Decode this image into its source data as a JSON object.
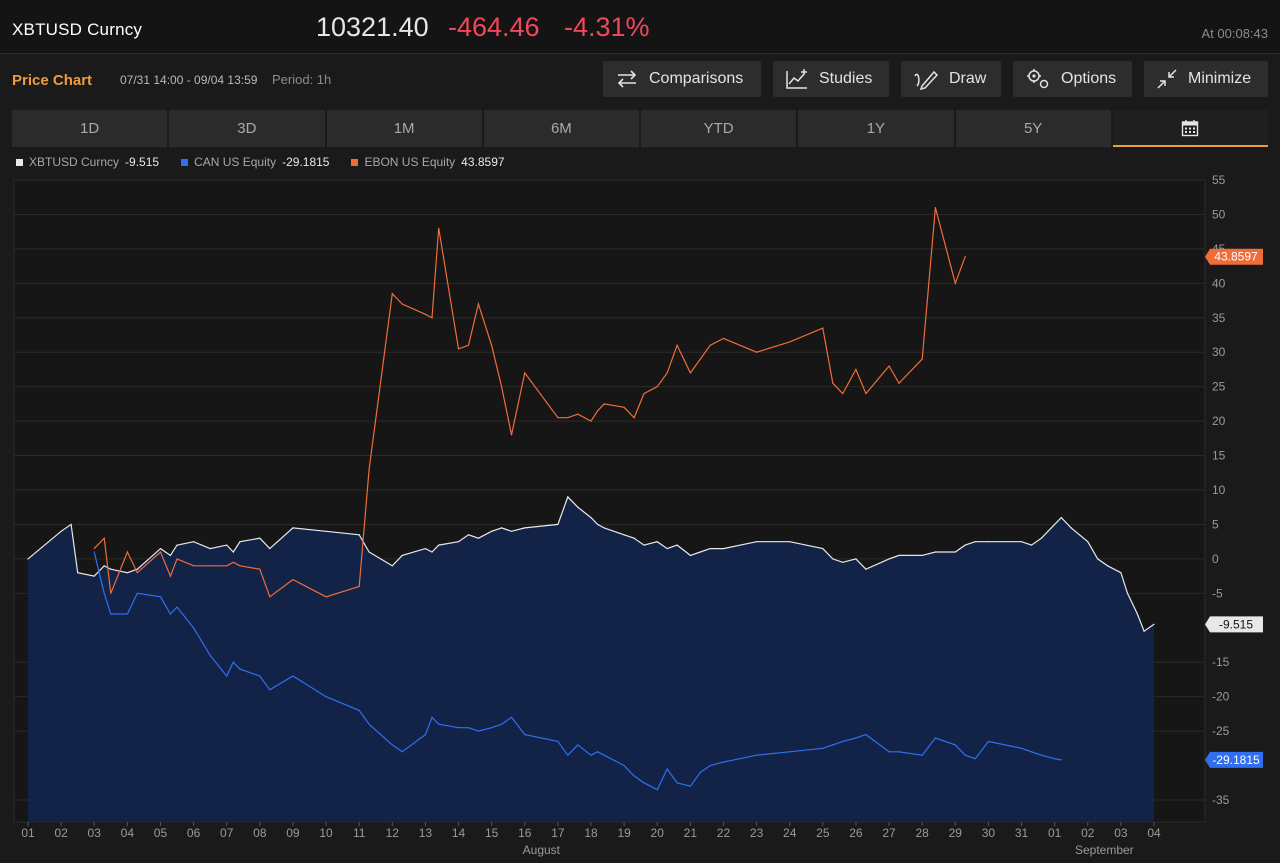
{
  "header": {
    "ticker": "XBTUSD Curncy",
    "last_price": "10321.40",
    "net_change": "-464.46",
    "pct_change": "-4.31%",
    "timestamp": "At 00:08:43"
  },
  "subbar": {
    "title": "Price Chart",
    "range": "07/31 14:00 - 09/04 13:59",
    "period": "Period: 1h"
  },
  "toolbar": {
    "comparisons": "Comparisons",
    "studies": "Studies",
    "draw": "Draw",
    "options": "Options",
    "minimize": "Minimize"
  },
  "tabs": [
    "1D",
    "3D",
    "1M",
    "6M",
    "YTD",
    "1Y",
    "5Y"
  ],
  "legend": [
    {
      "name": "XBTUSD Curncy",
      "value": "-9.515",
      "color": "#e8e8e8"
    },
    {
      "name": "CAN US Equity",
      "value": "-29.1815",
      "color": "#2f6ff0"
    },
    {
      "name": "EBON US Equity",
      "value": "43.8597",
      "color": "#f06c38"
    }
  ],
  "chart_data": {
    "type": "line",
    "ylim": [
      -38,
      55
    ],
    "y_ticks": [
      55,
      50,
      45,
      40,
      35,
      30,
      25,
      20,
      15,
      10,
      5,
      0,
      -5,
      -15,
      -20,
      -25,
      -35
    ],
    "x_ticks": [
      "01",
      "02",
      "03",
      "04",
      "05",
      "06",
      "07",
      "08",
      "09",
      "10",
      "11",
      "12",
      "13",
      "14",
      "15",
      "16",
      "17",
      "18",
      "19",
      "20",
      "21",
      "22",
      "23",
      "24",
      "25",
      "26",
      "27",
      "28",
      "29",
      "30",
      "31",
      "01",
      "02",
      "03",
      "04"
    ],
    "x_month_labels": [
      "August",
      "September"
    ],
    "end_labels": {
      "XBTUSD Curncy": "-9.515",
      "CAN US Equity": "-29.1815",
      "EBON US Equity": "43.8597"
    },
    "x": [
      0.0,
      1.0,
      1.3,
      1.5,
      2.0,
      2.3,
      2.5,
      3.0,
      3.3,
      4.0,
      4.3,
      4.5,
      5.0,
      5.5,
      6.0,
      6.2,
      6.4,
      7.0,
      7.3,
      8.0,
      9.0,
      10.0,
      10.3,
      11.0,
      11.3,
      12.0,
      12.2,
      12.4,
      13.0,
      13.3,
      13.6,
      14.0,
      14.3,
      14.6,
      15.0,
      16.0,
      16.3,
      16.6,
      17.0,
      17.2,
      17.4,
      18.0,
      18.3,
      18.6,
      19.0,
      19.3,
      19.6,
      20.0,
      20.3,
      20.6,
      21.0,
      22.0,
      23.0,
      24.0,
      24.3,
      24.6,
      25.0,
      25.3,
      26.0,
      26.3,
      27.0,
      27.4,
      28.0,
      28.3,
      28.6,
      29.0,
      30.0,
      30.3,
      30.6,
      31.0,
      31.2,
      31.5,
      32.0,
      32.3,
      32.6,
      33.0,
      33.2,
      33.5,
      33.7,
      34.0
    ],
    "series": [
      {
        "name": "XBTUSD Curncy",
        "values": [
          0.0,
          4.0,
          5.0,
          -2.0,
          -2.5,
          -1.0,
          -1.5,
          -2.0,
          -1.5,
          1.5,
          0.5,
          2.0,
          2.5,
          1.5,
          2.0,
          1.0,
          2.5,
          3.0,
          1.5,
          4.5,
          4.0,
          3.5,
          1.0,
          -1.0,
          0.5,
          1.5,
          1.0,
          2.0,
          2.5,
          3.5,
          3.0,
          4.0,
          4.5,
          4.0,
          4.5,
          5.0,
          9.0,
          7.5,
          6.0,
          5.0,
          4.5,
          3.5,
          3.0,
          2.0,
          2.5,
          1.5,
          2.0,
          0.5,
          1.0,
          1.5,
          1.5,
          2.5,
          2.5,
          1.5,
          0.0,
          -0.5,
          0.0,
          -1.5,
          0.0,
          0.5,
          0.5,
          1.0,
          1.0,
          2.0,
          2.5,
          2.5,
          2.5,
          2.0,
          3.0,
          5.0,
          6.0,
          4.5,
          2.5,
          0.0,
          -1.0,
          -2.0,
          -5.0,
          -8.0,
          -10.5,
          -9.5
        ]
      },
      {
        "name": "CAN US Equity",
        "values": [
          null,
          null,
          null,
          null,
          1.0,
          -5.0,
          -8.0,
          -8.0,
          -5.0,
          -5.5,
          -8.0,
          -7.0,
          -10.0,
          -14.0,
          -17.0,
          -15.0,
          -16.0,
          -17.0,
          -19.0,
          -17.0,
          -20.0,
          -22.0,
          -24.0,
          -27.0,
          -28.0,
          -25.5,
          -23.0,
          -24.0,
          -24.5,
          -24.5,
          -25.0,
          -24.5,
          -24.0,
          -23.0,
          -25.5,
          -26.5,
          -28.5,
          -27.0,
          -28.5,
          -28.0,
          -28.5,
          -30.0,
          -31.5,
          -32.5,
          -33.5,
          -30.5,
          -32.5,
          -33.0,
          -31.0,
          -30.0,
          -29.5,
          -28.5,
          -28.0,
          -27.5,
          -27.0,
          -26.5,
          -26.0,
          -25.5,
          -28.0,
          -28.0,
          -28.5,
          -26.0,
          -27.0,
          -28.5,
          -29.0,
          -26.5,
          -27.5,
          -28.0,
          -28.5,
          -29.0,
          -29.1815,
          null,
          null,
          null,
          null,
          null,
          null,
          null,
          null,
          null
        ]
      },
      {
        "name": "EBON US Equity",
        "values": [
          null,
          null,
          null,
          null,
          1.5,
          3.0,
          -5.0,
          1.0,
          -2.0,
          1.0,
          -2.5,
          0.0,
          -1.0,
          -1.0,
          -1.0,
          -0.5,
          -1.0,
          -1.5,
          -5.5,
          -3.0,
          -5.5,
          -4.0,
          13.0,
          38.5,
          37.0,
          35.5,
          35.0,
          48.0,
          30.5,
          31.0,
          37.0,
          31.0,
          25.0,
          18.0,
          27.0,
          20.5,
          20.5,
          21.0,
          20.0,
          21.5,
          22.5,
          22.0,
          20.5,
          24.0,
          25.0,
          27.0,
          31.0,
          27.0,
          29.0,
          31.0,
          32.0,
          30.0,
          31.5,
          33.5,
          25.5,
          24.0,
          27.5,
          24.0,
          28.0,
          25.5,
          29.0,
          51.0,
          40.0,
          43.8597,
          null,
          null,
          null,
          null,
          null,
          null,
          null,
          null,
          null,
          null,
          null,
          null,
          null,
          null,
          null,
          null
        ]
      }
    ]
  }
}
